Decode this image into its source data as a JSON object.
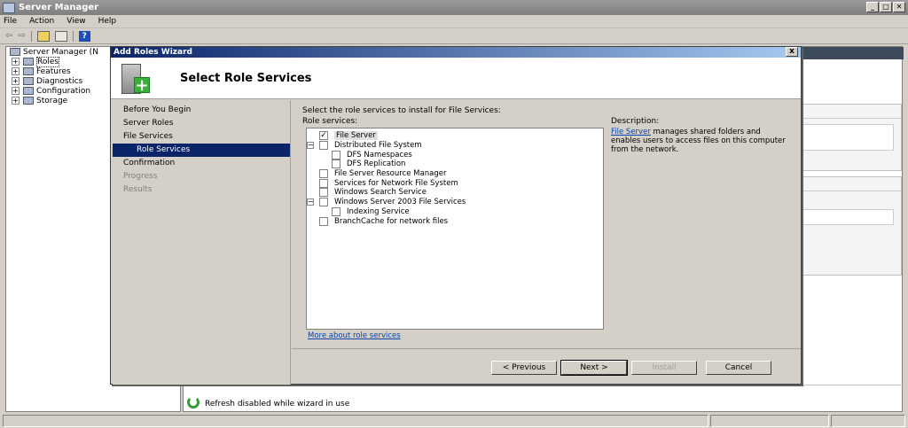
{
  "window": {
    "title": "Server Manager"
  },
  "menu": [
    "File",
    "Action",
    "View",
    "Help"
  ],
  "tree": {
    "root": "Server Manager (N",
    "items": [
      "Roles",
      "Features",
      "Diagnostics",
      "Configuration",
      "Storage"
    ]
  },
  "status": {
    "refresh": "Refresh disabled while wizard in use"
  },
  "wizard": {
    "title": "Add Roles Wizard",
    "close": "x",
    "heading": "Select Role Services",
    "nav": [
      "Before You Begin",
      "Server Roles",
      "File Services",
      "Role Services",
      "Confirmation",
      "Progress",
      "Results"
    ],
    "instruction": "Select the role services to install for File Services:",
    "role_services_label": "Role services:",
    "role_services": [
      {
        "label": "File Server",
        "checked": true
      },
      {
        "label": "Distributed File System",
        "checked": false
      },
      {
        "label": "DFS Namespaces",
        "checked": false
      },
      {
        "label": "DFS Replication",
        "checked": false
      },
      {
        "label": "File Server Resource Manager",
        "checked": false
      },
      {
        "label": "Services for Network File System",
        "checked": false
      },
      {
        "label": "Windows Search Service",
        "checked": false
      },
      {
        "label": "Windows Server 2003 File Services",
        "checked": false
      },
      {
        "label": "Indexing Service",
        "checked": false
      },
      {
        "label": "BranchCache for network files",
        "checked": false
      }
    ],
    "description_label": "Description:",
    "description_link": "File Server",
    "description_text": "manages shared folders and enables users to access files on this computer from the network.",
    "more_link": "More about role services",
    "buttons": {
      "previous": "< Previous",
      "next": "Next >",
      "install": "Install",
      "cancel": "Cancel"
    }
  }
}
